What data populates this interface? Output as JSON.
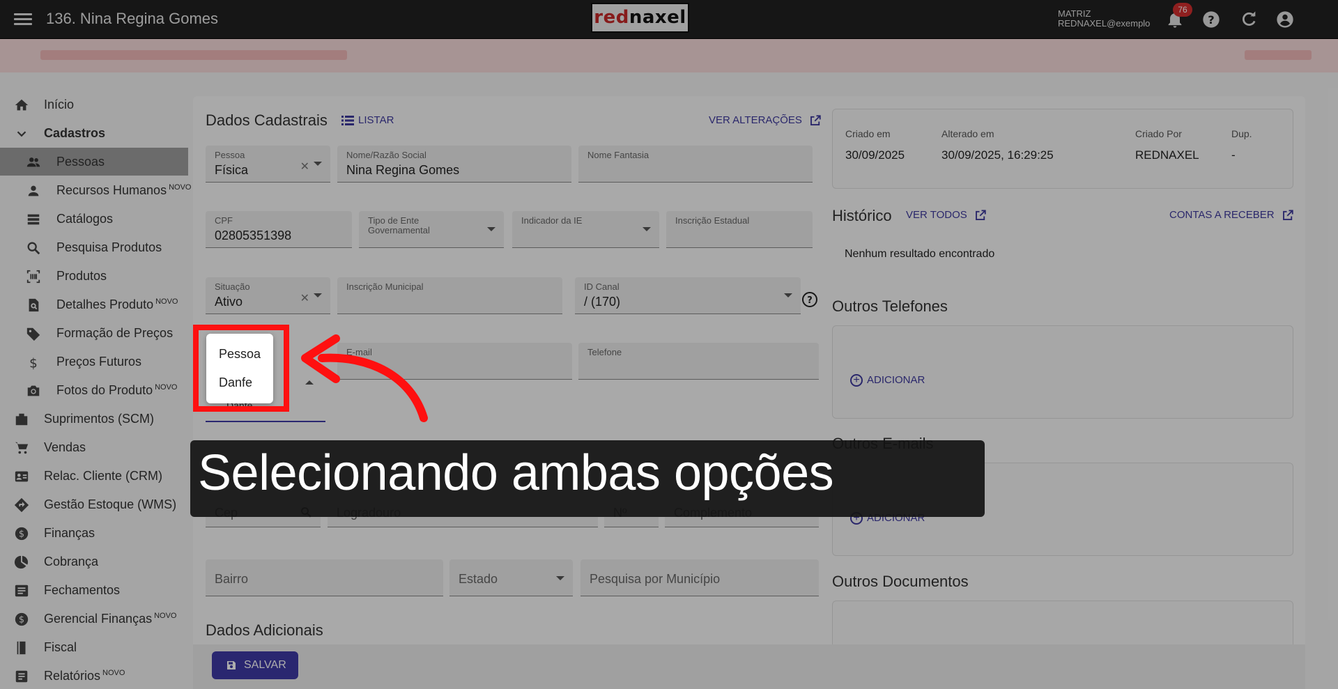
{
  "header": {
    "title": "136. Nina Regina Gomes",
    "logo_red": "red",
    "logo_black": "naxel",
    "user_line1": "MATRIZ",
    "user_line2": "REDNAXEL@exemplo",
    "notifications_count": "76"
  },
  "sidebar": {
    "items": [
      {
        "label": "Início",
        "icon": "home-icon"
      },
      {
        "label": "Cadastros",
        "icon": "chevron-down-icon"
      },
      {
        "label": "Pessoas",
        "icon": "people-icon"
      },
      {
        "label": "Recursos Humanos",
        "badge": "NOVO",
        "icon": "person-icon"
      },
      {
        "label": "Catálogos",
        "icon": "list-icon"
      },
      {
        "label": "Pesquisa Produtos",
        "icon": "search-icon"
      },
      {
        "label": "Produtos",
        "icon": "barcode-icon"
      },
      {
        "label": "Detalhes Produto",
        "badge": "NOVO",
        "icon": "doc-search-icon"
      },
      {
        "label": "Formação de Preços",
        "icon": "tag-icon"
      },
      {
        "label": "Preços Futuros",
        "icon": "dollar-icon"
      },
      {
        "label": "Fotos do Produto",
        "badge": "NOVO",
        "icon": "camera-icon"
      },
      {
        "label": "Suprimentos (SCM)",
        "icon": "box-icon"
      },
      {
        "label": "Vendas",
        "icon": "cart-icon"
      },
      {
        "label": "Relac. Cliente (CRM)",
        "icon": "contact-card-icon"
      },
      {
        "label": "Gestão Estoque (WMS)",
        "icon": "route-icon"
      },
      {
        "label": "Finanças",
        "icon": "money-icon"
      },
      {
        "label": "Cobrança",
        "icon": "pie-icon"
      },
      {
        "label": "Fechamentos",
        "icon": "report-icon"
      },
      {
        "label": "Gerencial Finanças",
        "badge": "NOVO",
        "icon": "money-icon"
      },
      {
        "label": "Fiscal",
        "icon": "book-icon"
      },
      {
        "label": "Relatórios",
        "badge": "NOVO",
        "icon": "report-icon"
      }
    ]
  },
  "form": {
    "title": "Dados Cadastrais",
    "list_link": "LISTAR",
    "changes_link": "VER ALTERAÇÕES",
    "pessoa_label": "Pessoa",
    "pessoa_value": "Física",
    "nome_label": "Nome/Razão Social",
    "nome_value": "Nina Regina Gomes",
    "fantasia_label": "Nome Fantasia",
    "cpf_label": "CPF",
    "cpf_value": "02805351398",
    "tipo_ente_label": "Tipo de Ente Governamental",
    "indicador_ie_label": "Indicador da IE",
    "inscricao_estadual_label": "Inscrição Estadual",
    "situacao_label": "Situação",
    "situacao_value": "Ativo",
    "inscricao_municipal_label": "Inscrição Municipal",
    "id_canal_label": "ID Canal",
    "id_canal_value": "/ (170)",
    "email_label": "E-mail",
    "telefone_label": "Telefone",
    "email_tipo_value": "Danfe",
    "cep_placeholder": "Cep",
    "logradouro_placeholder": "Logradouro",
    "numero_placeholder": "Nº",
    "complemento_placeholder": "Complemento",
    "bairro_placeholder": "Bairro",
    "estado_placeholder": "Estado",
    "municipio_placeholder": "Pesquisa por Município",
    "dados_adicionais": "Dados Adicionais",
    "save_label": "SALVAR"
  },
  "info": {
    "criado_em_label": "Criado em",
    "criado_em_value": "30/09/2025",
    "alterado_em_label": "Alterado em",
    "alterado_em_value": "30/09/2025, 16:29:25",
    "criado_por_label": "Criado Por",
    "criado_por_value": "REDNAXEL",
    "dup_label": "Dup.",
    "dup_value": "-"
  },
  "historico": {
    "title": "Histórico",
    "ver_todos": "VER TODOS",
    "contas_link": "CONTAS A RECEBER",
    "empty": "Nenhum resultado encontrado"
  },
  "outros": {
    "telefones_title": "Outros Telefones",
    "emails_title": "Outros E-mails",
    "documentos_title": "Outros Documentos",
    "add_label": "ADICIONAR"
  },
  "popup": {
    "options": [
      "Pessoa",
      "Danfe"
    ]
  },
  "annotation": {
    "caption": "Selecionando ambas opções"
  },
  "colors": {
    "accent": "#3f3aa6",
    "highlight": "#ff1010",
    "topbar": "#212121"
  }
}
